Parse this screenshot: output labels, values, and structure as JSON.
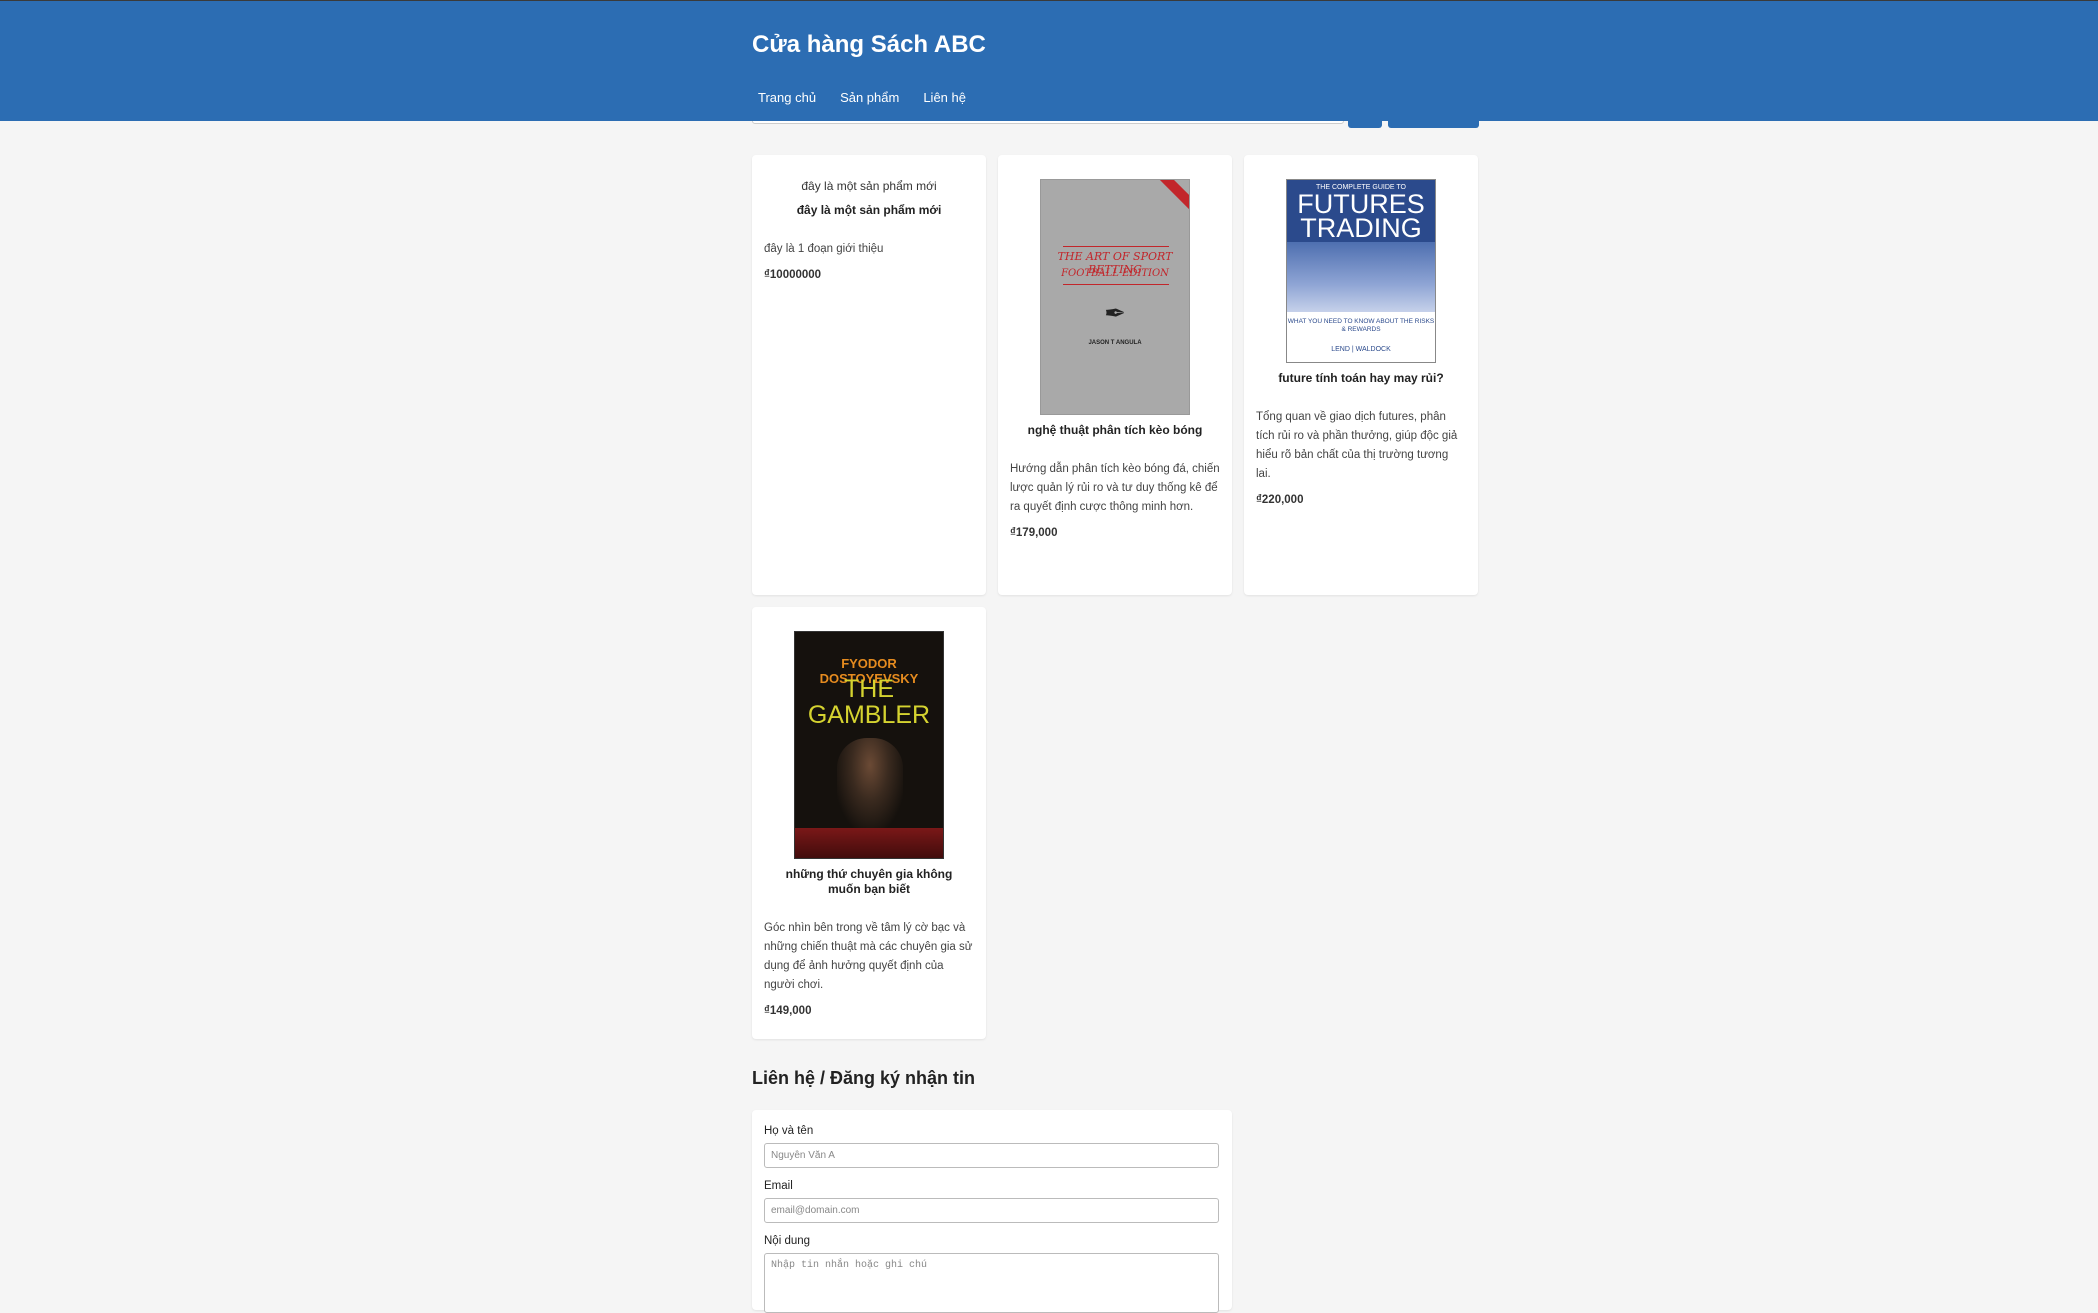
{
  "header": {
    "title": "Cửa hàng Sách ABC",
    "nav": [
      "Trang chủ",
      "Sản phẩm",
      "Liên hệ"
    ]
  },
  "products": [
    {
      "image_alt": "đây là một sản phẩm mới",
      "title": "đây là một sản phẩm mới",
      "description": "đây là 1 đoạn giới thiệu",
      "price": "₫10000000"
    },
    {
      "cover": {
        "title_line1": "THE ART OF SPORT BETTING",
        "title_line2": "FOOTBALL EDITION",
        "author": "JASON T ANGULA"
      },
      "title": "nghệ thuật phân tích kèo bóng",
      "description": "Hướng dẫn phân tích kèo bóng đá, chiến lược quản lý rủi ro và tư duy thống kê để ra quyết định cược thông minh hơn.",
      "price": "₫179,000"
    },
    {
      "cover": {
        "kicker": "THE COMPLETE GUIDE TO",
        "title": "FUTURES TRADING",
        "subtitle": "WHAT YOU NEED TO KNOW ABOUT THE RISKS & REWARDS",
        "author": "LEND | WALDOCK"
      },
      "title": "future tính toán hay may rủi?",
      "description": "Tổng quan về giao dịch futures, phân tích rủi ro và phần thưởng, giúp độc giả hiểu rõ bản chất của thị trường tương lai.",
      "price": "₫220,000"
    },
    {
      "cover": {
        "author": "FYODOR DOSTOYEVSKY",
        "title": "THE GAMBLER"
      },
      "title": "những thứ chuyên gia không muốn bạn biết",
      "description": "Góc nhìn bên trong về tâm lý cờ bạc và những chiến thuật mà các chuyên gia sử dụng để ảnh hưởng quyết định của người chơi.",
      "price": "₫149,000"
    }
  ],
  "contact": {
    "section_title": "Liên hệ / Đăng ký nhận tin",
    "name_label": "Họ và tên",
    "name_placeholder": "Nguyễn Văn A",
    "email_label": "Email",
    "email_placeholder": "email@domain.com",
    "message_label": "Nội dung",
    "message_placeholder": "Nhập tin nhắn hoặc ghi chú"
  },
  "colors": {
    "header_bg": "#2c6db3",
    "page_bg": "#f5f5f5"
  }
}
